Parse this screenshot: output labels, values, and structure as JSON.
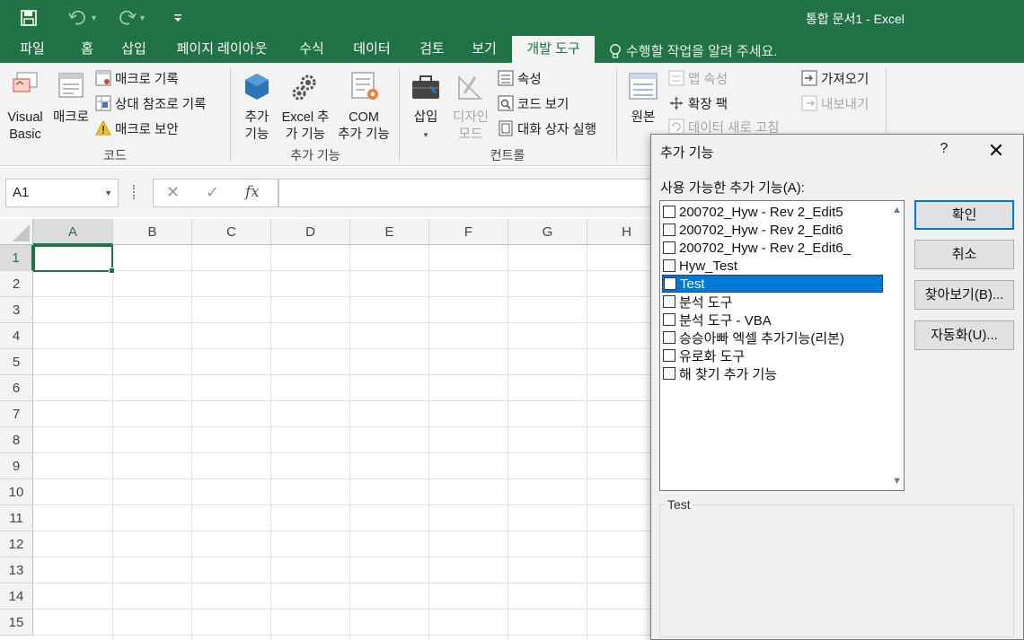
{
  "window": {
    "title": "통합 문서1 - Excel"
  },
  "colors": {
    "brand": "#217346",
    "selection": "#0078d7"
  },
  "qat": {
    "save_icon": "save-icon",
    "undo_icon": "undo-icon",
    "redo_icon": "redo-icon",
    "customize_icon": "customize-qat-icon"
  },
  "tabs": [
    {
      "label": "파일"
    },
    {
      "label": "홈"
    },
    {
      "label": "삽입"
    },
    {
      "label": "페이지 레이아웃"
    },
    {
      "label": "수식"
    },
    {
      "label": "데이터"
    },
    {
      "label": "검토"
    },
    {
      "label": "보기"
    },
    {
      "label": "개발 도구"
    }
  ],
  "active_tab": "개발 도구",
  "tell_me": "수행할 작업을 알려 주세요.",
  "ribbon": {
    "code": {
      "group": "코드",
      "visual_basic": [
        "Visual",
        "Basic"
      ],
      "macros": "매크로",
      "record_macro": "매크로 기록",
      "relative_ref": "상대 참조로 기록",
      "macro_security": "매크로 보안"
    },
    "addins": {
      "group": "추가 기능",
      "addins": [
        "추가",
        "기능"
      ],
      "excel_addins": [
        "Excel 추",
        "가 기능"
      ],
      "com_addins": [
        "COM",
        "추가 기능"
      ]
    },
    "controls": {
      "group": "컨트롤",
      "insert": "삽입",
      "design_mode": [
        "디자인",
        "모드"
      ],
      "properties": "속성",
      "view_code": "코드 보기",
      "run_dialog": "대화 상자 실행"
    },
    "xml": {
      "source": "원본",
      "map_properties": "맵 속성",
      "expansion_packs": "확장 팩",
      "refresh_data": "데이터 새로 고침",
      "import": "가져오기",
      "export": "내보내기"
    }
  },
  "formula_bar": {
    "name_box": "A1",
    "fx": "fx",
    "cancel": "✕",
    "enter": "✓"
  },
  "sheet": {
    "columns": [
      "A",
      "B",
      "C",
      "D",
      "E",
      "F",
      "G",
      "H"
    ],
    "rows": [
      "1",
      "2",
      "3",
      "4",
      "5",
      "6",
      "7",
      "8",
      "9",
      "10",
      "11",
      "12",
      "13",
      "14",
      "15"
    ],
    "active_cell": "A1"
  },
  "dialog": {
    "title": "추가 기능",
    "help": "?",
    "close": "✕",
    "list_label": "사용 가능한 추가 기능(A):",
    "items": [
      {
        "label": "200702_Hyw - Rev 2_Edit5",
        "checked": false
      },
      {
        "label": "200702_Hyw - Rev 2_Edit6",
        "checked": false
      },
      {
        "label": "200702_Hyw - Rev 2_Edit6_",
        "checked": false
      },
      {
        "label": "Hyw_Test",
        "checked": false
      },
      {
        "label": "Test",
        "checked": false,
        "selected": true
      },
      {
        "label": "분석 도구",
        "checked": false
      },
      {
        "label": "분석 도구 - VBA",
        "checked": false
      },
      {
        "label": "승승아빠 엑셀 추가기능(리본)",
        "checked": false
      },
      {
        "label": "유로화 도구",
        "checked": false
      },
      {
        "label": "해 찾기 추가 기능",
        "checked": false
      }
    ],
    "buttons": {
      "ok": "확인",
      "cancel": "취소",
      "browse": "찾아보기(B)...",
      "automation": "자동화(U)..."
    },
    "description_title": "Test"
  }
}
